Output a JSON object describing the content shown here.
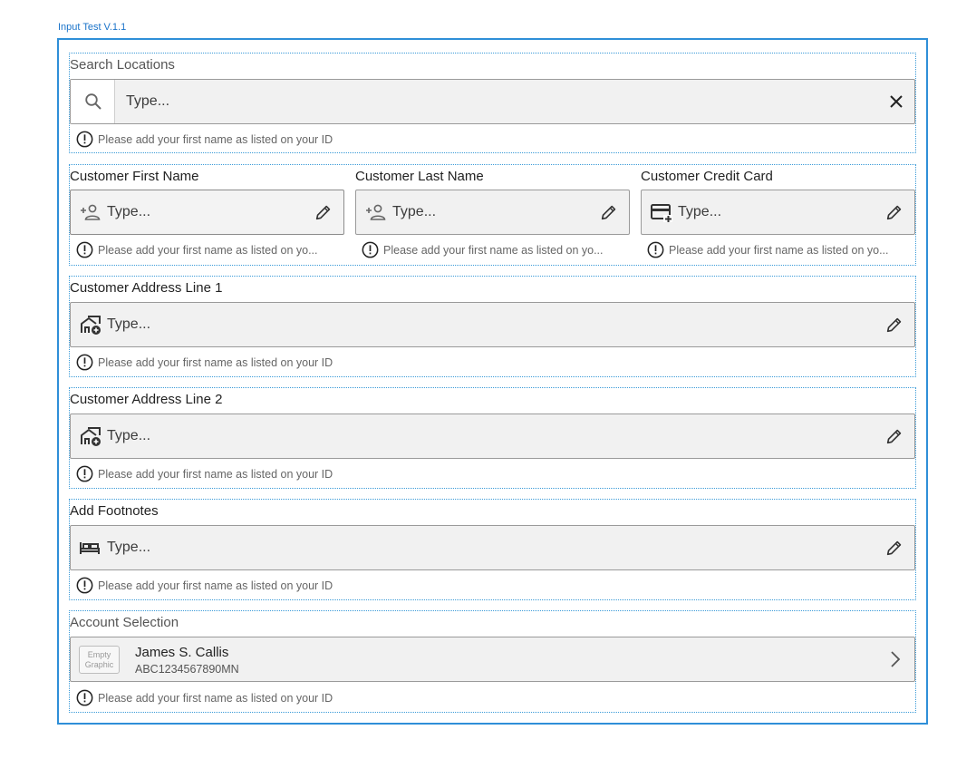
{
  "frame": {
    "title": "Input Test V.1.1"
  },
  "helper_text": "Please add your first name as listed on your ID",
  "helper_text_truncated": "Please add your first name as listed on yo...",
  "search": {
    "label": "Search Locations",
    "placeholder": "Type..."
  },
  "customer_row": {
    "first_name": {
      "label": "Customer First Name",
      "placeholder": "Type..."
    },
    "last_name": {
      "label": "Customer Last Name",
      "placeholder": "Type..."
    },
    "credit_card": {
      "label": "Customer Credit Card",
      "placeholder": "Type..."
    }
  },
  "address1": {
    "label": "Customer Address Line 1",
    "placeholder": "Type..."
  },
  "address2": {
    "label": "Customer Address Line 2",
    "placeholder": "Type..."
  },
  "footnotes": {
    "label": "Add Footnotes",
    "placeholder": "Type..."
  },
  "account": {
    "label": "Account Selection",
    "empty_graphic": "Empty Graphic",
    "name": "James S. Callis",
    "id": "ABC1234567890MN"
  },
  "icons": {
    "search": "search-icon",
    "clear": "close-icon",
    "add_person": "add-person-icon",
    "credit_card": "add-card-icon",
    "address": "add-home-icon",
    "bed": "bed-icon",
    "edit": "pencil-icon",
    "alert": "alert-circle-icon",
    "chevron": "chevron-right-icon"
  },
  "colors": {
    "frame_border": "#2f8fd8",
    "group_border": "#3b9bd8",
    "field_bg": "#f1f1f1"
  }
}
